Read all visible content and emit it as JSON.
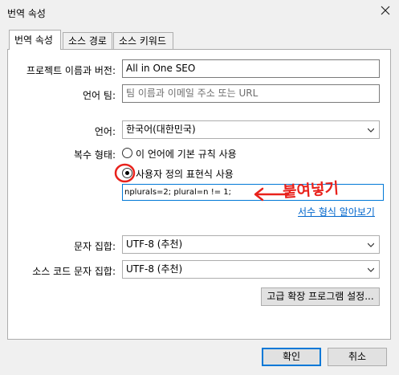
{
  "window": {
    "title": "번역 속성"
  },
  "tabs": [
    {
      "label": "번역 속성",
      "active": true
    },
    {
      "label": "소스 경로",
      "active": false
    },
    {
      "label": "소스 키워드",
      "active": false
    }
  ],
  "form": {
    "project_label": "프로젝트 이름과 버전:",
    "project_value": "All in One SEO",
    "language_team_label": "언어 팀:",
    "language_team_placeholder": "팀 이름과 이메일 주소 또는 URL",
    "language_label": "언어:",
    "language_value": "한국어(대한민국)",
    "plural_label": "복수 형태:",
    "plural_option_default": "이 언어에 기본 규칙 사용",
    "plural_option_custom": "사용자 정의 표현식 사용",
    "plural_expression": "nplurals=2; plural=n != 1;",
    "plural_help_link": "서수 형식 알아보기",
    "charset_label": "문자 집합:",
    "charset_value": "UTF-8 (추천)",
    "source_charset_label": "소스 코드 문자 집합:",
    "source_charset_value": "UTF-8 (추천)",
    "advanced_button": "고급 확장 프로그램 설정..."
  },
  "annotation": {
    "handwritten_text": "붙여넣기",
    "color": "#e8221c"
  },
  "buttons": {
    "ok": "확인",
    "cancel": "취소"
  },
  "colors": {
    "link": "#0066cc",
    "default_border": "#0078d7"
  }
}
